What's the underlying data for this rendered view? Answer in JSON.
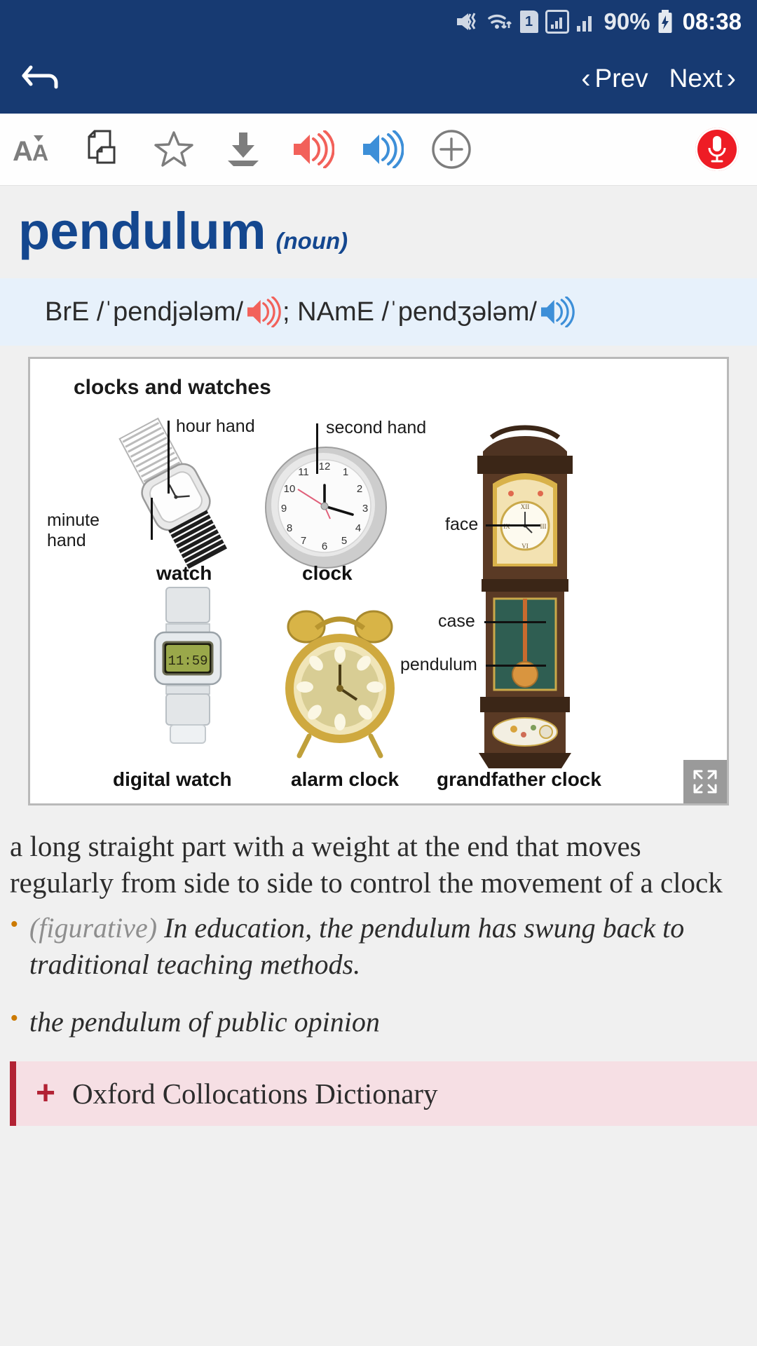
{
  "status_bar": {
    "icons": [
      "mute-vibrate-icon",
      "wifi-icon",
      "sim-1-icon",
      "signal-boxed-icon",
      "signal-bars-icon"
    ],
    "sim_label": "1",
    "battery_percent": "90%",
    "time": "08:38"
  },
  "nav_bar": {
    "back_icon": "back-arrow-icon",
    "prev_label": "Prev",
    "next_label": "Next",
    "prev_chevron": "‹",
    "next_chevron": "›"
  },
  "toolbar": {
    "items": [
      {
        "name": "font-size-icon",
        "label": "AĂ"
      },
      {
        "name": "copy-document-icon",
        "label": ""
      },
      {
        "name": "star-favorite-icon",
        "label": ""
      },
      {
        "name": "download-icon",
        "label": ""
      },
      {
        "name": "speaker-british-icon",
        "label": ""
      },
      {
        "name": "speaker-american-icon",
        "label": ""
      },
      {
        "name": "add-plus-circle-icon",
        "label": ""
      }
    ],
    "mic_button": "microphone-record-button",
    "colors": {
      "british_red": "#f2615a",
      "american_blue": "#3d8fd8",
      "mic_red": "#ee1c25",
      "grey": "#7d7d7d"
    }
  },
  "entry": {
    "headword": "pendulum",
    "part_of_speech": "(noun)",
    "pronunciation": {
      "bre_label": "BrE",
      "bre_ipa": "/ˈpendjələm/",
      "separator": "; ",
      "name_label": "NAmE",
      "name_ipa": "/ˈpendʒələm/"
    },
    "definition": "a long straight part with a weight at the end that moves regularly from side to side to control the movement of a clock",
    "examples": [
      {
        "tag": "(figurative)",
        "text": " In education, the pendulum has swung back to traditional teaching methods."
      },
      {
        "tag": "",
        "text": "the pendulum of public opinion"
      }
    ]
  },
  "illustration": {
    "title": "clocks and watches",
    "expand_icon": "expand-fullscreen-icon",
    "labels": [
      {
        "name": "label-hour-hand",
        "text": "hour hand"
      },
      {
        "name": "label-second-hand",
        "text": "second hand"
      },
      {
        "name": "label-minute-hand",
        "text": "minute\nhand"
      },
      {
        "name": "label-face",
        "text": "face"
      },
      {
        "name": "label-case",
        "text": "case"
      },
      {
        "name": "label-pendulum",
        "text": "pendulum"
      }
    ],
    "captions": [
      {
        "name": "caption-watch",
        "text": "watch"
      },
      {
        "name": "caption-clock",
        "text": "clock"
      },
      {
        "name": "caption-digital-watch",
        "text": "digital watch"
      },
      {
        "name": "caption-alarm-clock",
        "text": "alarm clock"
      },
      {
        "name": "caption-grandfather-clock",
        "text": "grandfather clock"
      }
    ],
    "digital_display": "11:59",
    "clock_numerals": [
      "12",
      "1",
      "2",
      "3",
      "4",
      "5",
      "6",
      "7",
      "8",
      "9",
      "10",
      "11"
    ]
  },
  "collocations": {
    "title": "Oxford Collocations Dictionary",
    "plus": "+",
    "accent": "#b22234"
  },
  "theme": {
    "nav_blue": "#173a72",
    "headword_blue": "#14478f",
    "phon_bg": "#e7f1fb",
    "page_bg": "#f0f0f0"
  }
}
